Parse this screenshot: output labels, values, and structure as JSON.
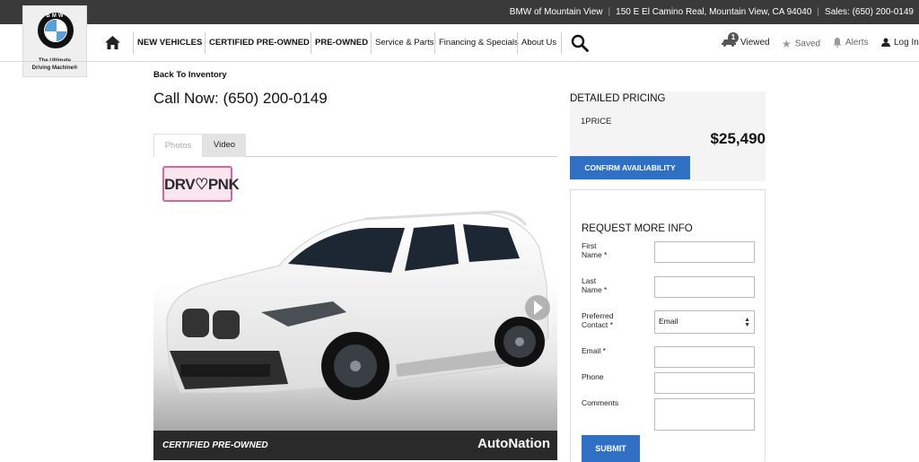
{
  "topbar": {
    "dealer": "BMW of Mountain View",
    "address": "150 E El Camino Real, Mountain View, CA 94040",
    "sales": "Sales: (650) 200-0149"
  },
  "logo": {
    "letters": "BMW",
    "tagline_1": "The Ultimate",
    "tagline_2": "Driving Machine®"
  },
  "nav": {
    "items": [
      "NEW VEHICLES",
      "CERTIFIED PRE-OWNED",
      "PRE-OWNED",
      "Service & Parts",
      "Financing & Specials",
      "About Us"
    ],
    "viewed_count": "1",
    "viewed": "Viewed",
    "saved": "Saved",
    "alerts": "Alerts",
    "login": "Log In"
  },
  "main": {
    "back": "Back To Inventory",
    "call": "Call Now: (650) 200-0149",
    "tabs": [
      "Photos",
      "Video"
    ],
    "plate_text": "DRV♡PNK",
    "photo_label": "CERTIFIED PRE-OWNED",
    "photo_brand": "AutoNation"
  },
  "pricing": {
    "title": "DETAILED PRICING",
    "label": "1PRICE",
    "value": "$25,490",
    "confirm": "CONFIRM AVAILIABILITY"
  },
  "form": {
    "title": "REQUEST MORE INFO",
    "first_name_1": "First",
    "first_name_2": "Name *",
    "last_name_1": "Last",
    "last_name_2": "Name *",
    "preferred_1": "Preferred",
    "preferred_2": "Contact *",
    "preferred_value": "Email",
    "email": "Email *",
    "phone": "Phone",
    "comments": "Comments",
    "submit": "SUBMIT"
  },
  "colors": {
    "accent": "#2f6fc4",
    "topbar": "#3a3a3a"
  }
}
